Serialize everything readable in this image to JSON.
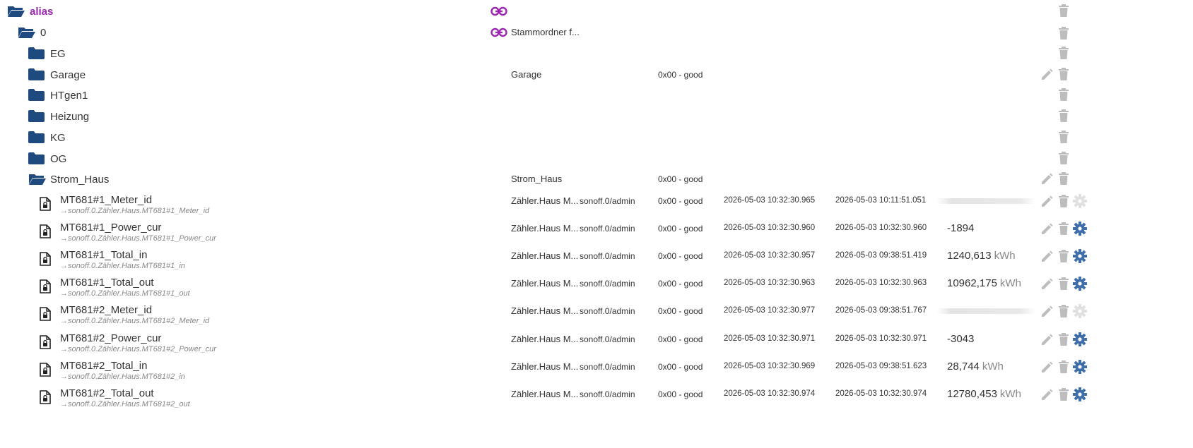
{
  "colors": {
    "folder": "#1e4a80",
    "alias": "#9c27b0",
    "action": "#bdbdbd",
    "gear": "#3f6ea8"
  },
  "tree": {
    "root": {
      "name": "alias"
    },
    "zero": {
      "name": "0",
      "role": "Stammordner f..."
    },
    "folders": [
      {
        "name": "EG"
      },
      {
        "name": "Garage",
        "role": "Garage",
        "quality": "0x00 - good"
      },
      {
        "name": "HTgen1"
      },
      {
        "name": "Heizung"
      },
      {
        "name": "KG"
      },
      {
        "name": "OG"
      },
      {
        "name": "Strom_Haus",
        "role": "Strom_Haus",
        "quality": "0x00 - good"
      }
    ],
    "states": [
      {
        "name": "MT681#1_Meter_id",
        "alias_of": "→sonoff.0.Zähler.Haus.MT681#1_Meter_id",
        "role": "Zähler.Haus M...",
        "room": "sonoff.0/admin",
        "quality": "0x00 - good",
        "ts": "2026-05-03 10:32:30.965",
        "lc": "2026-05-03 10:11:51.051",
        "value": "",
        "unit": "",
        "gear_active": false
      },
      {
        "name": "MT681#1_Power_cur",
        "alias_of": "→sonoff.0.Zähler.Haus.MT681#1_Power_cur",
        "role": "Zähler.Haus M...",
        "room": "sonoff.0/admin",
        "quality": "0x00 - good",
        "ts": "2026-05-03 10:32:30.960",
        "lc": "2026-05-03 10:32:30.960",
        "value": "-1894",
        "unit": "",
        "gear_active": true
      },
      {
        "name": "MT681#1_Total_in",
        "alias_of": "→sonoff.0.Zähler.Haus.MT681#1_in",
        "role": "Zähler.Haus M...",
        "room": "sonoff.0/admin",
        "quality": "0x00 - good",
        "ts": "2026-05-03 10:32:30.957",
        "lc": "2026-05-03 09:38:51.419",
        "value": "1240,613",
        "unit": "kWh",
        "gear_active": true
      },
      {
        "name": "MT681#1_Total_out",
        "alias_of": "→sonoff.0.Zähler.Haus.MT681#1_out",
        "role": "Zähler.Haus M...",
        "room": "sonoff.0/admin",
        "quality": "0x00 - good",
        "ts": "2026-05-03 10:32:30.963",
        "lc": "2026-05-03 10:32:30.963",
        "value": "10962,175",
        "unit": "kWh",
        "gear_active": true
      },
      {
        "name": "MT681#2_Meter_id",
        "alias_of": "→sonoff.0.Zähler.Haus.MT681#2_Meter_id",
        "role": "Zähler.Haus M...",
        "room": "sonoff.0/admin",
        "quality": "0x00 - good",
        "ts": "2026-05-03 10:32:30.977",
        "lc": "2026-05-03 09:38:51.767",
        "value": "",
        "unit": "",
        "gear_active": false
      },
      {
        "name": "MT681#2_Power_cur",
        "alias_of": "→sonoff.0.Zähler.Haus.MT681#2_Power_cur",
        "role": "Zähler.Haus M...",
        "room": "sonoff.0/admin",
        "quality": "0x00 - good",
        "ts": "2026-05-03 10:32:30.971",
        "lc": "2026-05-03 10:32:30.971",
        "value": "-3043",
        "unit": "",
        "gear_active": true
      },
      {
        "name": "MT681#2_Total_in",
        "alias_of": "→sonoff.0.Zähler.Haus.MT681#2_in",
        "role": "Zähler.Haus M...",
        "room": "sonoff.0/admin",
        "quality": "0x00 - good",
        "ts": "2026-05-03 10:32:30.969",
        "lc": "2026-05-03 09:38:51.623",
        "value": "28,744",
        "unit": "kWh",
        "gear_active": true
      },
      {
        "name": "MT681#2_Total_out",
        "alias_of": "→sonoff.0.Zähler.Haus.MT681#2_out",
        "role": "Zähler.Haus M...",
        "room": "sonoff.0/admin",
        "quality": "0x00 - good",
        "ts": "2026-05-03 10:32:30.974",
        "lc": "2026-05-03 10:32:30.974",
        "value": "12780,453",
        "unit": "kWh",
        "gear_active": true
      }
    ]
  }
}
